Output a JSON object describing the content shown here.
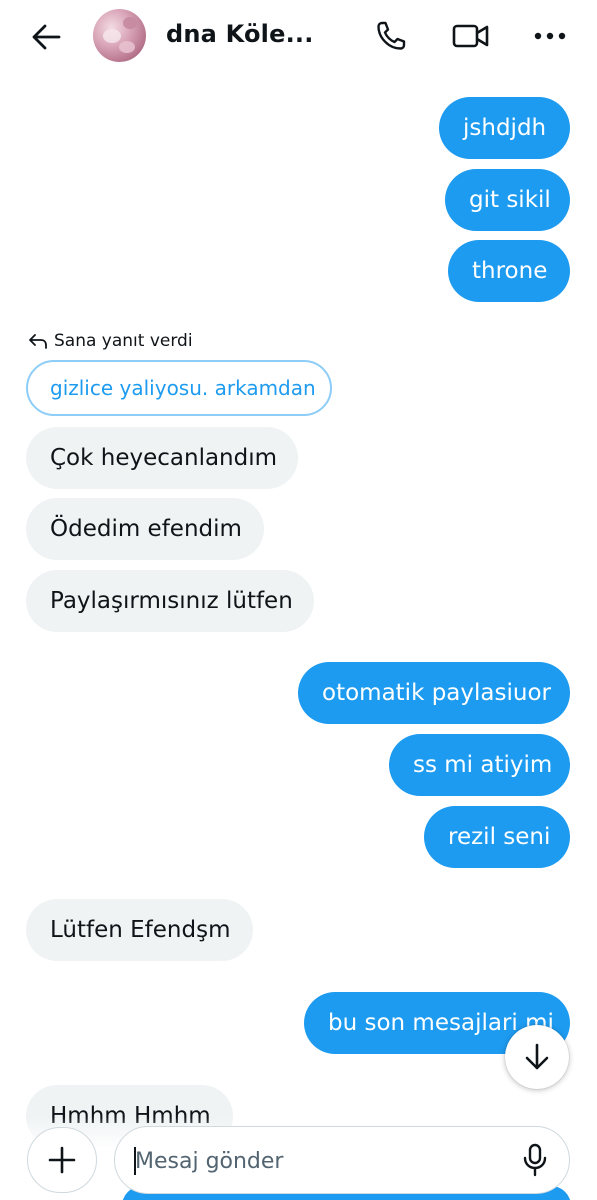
{
  "header": {
    "contact_name": "dna Köle...",
    "icons": {
      "back": "arrow-left-icon",
      "call": "phone-icon",
      "video": "video-camera-icon",
      "more": "more-horizontal-icon"
    }
  },
  "colors": {
    "outgoing_bubble": "#1d9bf0",
    "incoming_bubble": "#eff3f4",
    "quoted_border": "#8ecdf7",
    "text_primary": "#0f1419"
  },
  "messages": [
    {
      "direction": "outgoing",
      "text": "jshdjdh"
    },
    {
      "direction": "outgoing",
      "text": "git sikil"
    },
    {
      "direction": "outgoing",
      "text": "throne"
    },
    {
      "direction": "incoming",
      "text": "Çok heyecanlandım"
    },
    {
      "direction": "incoming",
      "text": "Ödedim efendim"
    },
    {
      "direction": "incoming",
      "text": "Paylaşırmısınız lütfen"
    },
    {
      "direction": "outgoing",
      "text": "otomatik paylasiuor"
    },
    {
      "direction": "outgoing",
      "text": "ss mi atiyim"
    },
    {
      "direction": "outgoing",
      "text": "rezil seni"
    },
    {
      "direction": "incoming",
      "text": "Lütfen Efendşm"
    },
    {
      "direction": "outgoing",
      "text": "bu son mesajlari mi"
    },
    {
      "direction": "incoming",
      "text": "Hmhm Hmhm"
    }
  ],
  "reply": {
    "label": "Sana yanıt verdi",
    "quoted_text": "gizlice yaliyosu. arkamdan",
    "icon": "reply-arrow-icon"
  },
  "composer": {
    "placeholder": "Mesaj gönder",
    "value": "",
    "add_icon": "plus-icon",
    "mic_icon": "microphone-icon",
    "scroll_icon": "arrow-down-icon"
  }
}
